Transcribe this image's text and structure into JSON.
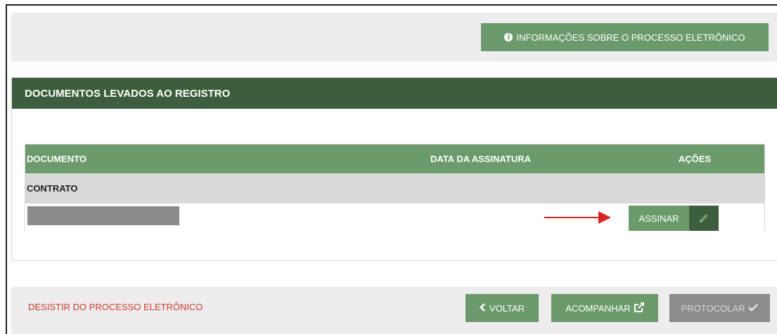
{
  "info_bar": {
    "button_label": "INFORMAÇÕES SOBRE O PROCESSO ELETRÔNICO",
    "button_icon": "info-circle-icon"
  },
  "panel": {
    "title": "DOCUMENTOS LEVADOS AO REGISTRO",
    "table": {
      "columns": [
        "DOCUMENTO",
        "DATA DA ASSINATURA",
        "AÇÕES"
      ],
      "groups": [
        {
          "name": "CONTRATO",
          "rows": [
            {
              "document": "",
              "signature_date": "",
              "action_label": "ASSINAR",
              "action_icon": "pencil-icon"
            }
          ]
        }
      ]
    }
  },
  "footer": {
    "quit_label": "DESISTIR DO PROCESSO ELETRÔNICO",
    "back_label": "VOLTAR",
    "track_label": "ACOMPANHAR",
    "protocol_label": "PROTOCOLAR"
  },
  "colors": {
    "primary_green": "#6b9a6b",
    "dark_green": "#3c5e3c",
    "danger_red": "#d43a2a",
    "disabled_gray": "#8c8c8c",
    "annotation_arrow": "#e02020"
  }
}
